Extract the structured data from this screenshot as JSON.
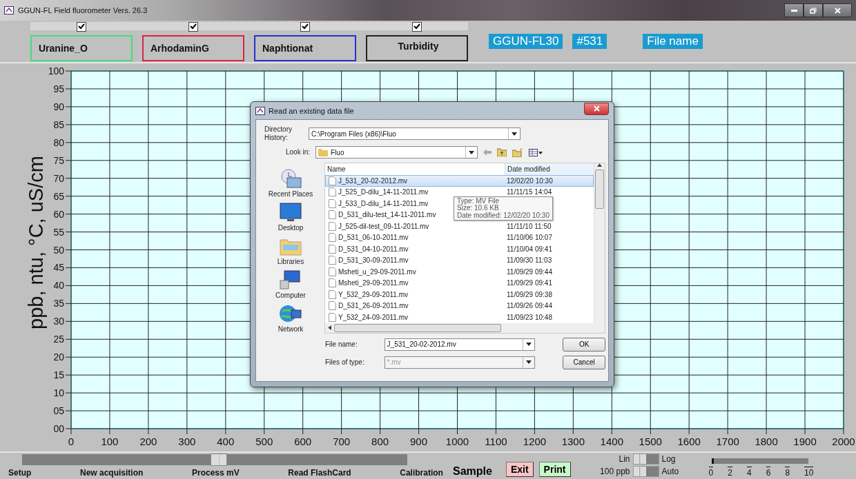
{
  "window": {
    "title": "GGUN-FL Field fluorometer Vers. 26.3"
  },
  "channels": [
    {
      "label": "Uranine_O",
      "checked": true,
      "color": "#44dd77"
    },
    {
      "label": "ArhodaminG",
      "checked": true,
      "color": "#dd2244"
    },
    {
      "label": "Naphtionat",
      "checked": true,
      "color": "#2233cc"
    },
    {
      "label": "Turbidity",
      "checked": true,
      "color": "#222222"
    }
  ],
  "info_labels": [
    "GGUN-FL30",
    "#531",
    "File name"
  ],
  "plot": {
    "ylabel": "ppb, ntu, °C, uS/cm",
    "yticks": [
      "100",
      "95",
      "90",
      "85",
      "80",
      "75",
      "70",
      "65",
      "60",
      "55",
      "50",
      "45",
      "40",
      "35",
      "30",
      "25",
      "20",
      "15",
      "10",
      "05",
      "00"
    ],
    "xticks": [
      "0",
      "100",
      "200",
      "300",
      "400",
      "500",
      "600",
      "700",
      "800",
      "900",
      "1000",
      "1100",
      "1200",
      "1300",
      "1400",
      "1500",
      "1600",
      "1700",
      "1800",
      "1900",
      "2000"
    ]
  },
  "dialog": {
    "title": "Read an existing data file",
    "directory_history": {
      "label": "Directory History:",
      "value": "C:\\Program Files (x86)\\Fluo"
    },
    "look_in": {
      "label": "Look in:",
      "value": "Fluo"
    },
    "places": [
      {
        "label": "Recent Places",
        "kind": "recent"
      },
      {
        "label": "Desktop",
        "kind": "desktop"
      },
      {
        "label": "Libraries",
        "kind": "libraries"
      },
      {
        "label": "Computer",
        "kind": "computer"
      },
      {
        "label": "Network",
        "kind": "network"
      }
    ],
    "columns": [
      "Name",
      "Date modified"
    ],
    "files": [
      {
        "name": "J_531_20-02-2012.mv",
        "date": "12/02/20 10:30",
        "selected": true
      },
      {
        "name": "J_525_D-dilu_14-11-2011.mv",
        "date": "11/11/15 14:04",
        "selected": false
      },
      {
        "name": "J_533_D-dilu_14-11-2011.mv",
        "selected": false
      },
      {
        "name": "D_531_dilu-test_14-11-2011.mv",
        "selected": false
      },
      {
        "name": "J_525-dil-test_09-11-2011.mv",
        "date": "11/11/10 11:50",
        "selected": false
      },
      {
        "name": "D_531_06-10-2011.mv",
        "date": "11/10/06 10:07",
        "selected": false
      },
      {
        "name": "D_531_04-10-2011.mv",
        "date": "11/10/04 09:41",
        "selected": false
      },
      {
        "name": "D_531_30-09-2011.mv",
        "date": "11/09/30 11:03",
        "selected": false
      },
      {
        "name": "Msheti_u_29-09-2011.mv",
        "date": "11/09/29 09:44",
        "selected": false
      },
      {
        "name": "Msheti_29-09-2011.mv",
        "date": "11/09/29 09:41",
        "selected": false
      },
      {
        "name": "Y_532_29-09-2011.mv",
        "date": "11/09/29 09:38",
        "selected": false
      },
      {
        "name": "D_531_26-09-2011.mv",
        "date": "11/09/26 09:44",
        "selected": false
      },
      {
        "name": "Y_532_24-09-2011.mv",
        "date": "11/09/23 10:48",
        "selected": false
      }
    ],
    "tooltip": [
      "Type: MV File",
      "Size: 10.6 KB",
      "Date modified: 12/02/20 10:30"
    ],
    "file_name": {
      "label": "File name:",
      "value": "J_531_20-02-2012.mv"
    },
    "file_type": {
      "label": "Files of type:",
      "value": "*.mv",
      "disabled": true
    },
    "buttons": [
      "OK",
      "Cancel"
    ]
  },
  "mode_slider": {
    "level": 0.51,
    "labels": [
      "Setup",
      "New acquisition",
      "Process mV",
      "Read FlashCard",
      "Calibration"
    ]
  },
  "sample_label": "Sample",
  "actions": [
    {
      "label": "Exit",
      "kind": "exit"
    },
    {
      "label": "Print",
      "kind": "print"
    }
  ],
  "toggles": [
    {
      "left": "Lin",
      "right": "Log",
      "on": false
    },
    {
      "left": "100 ppb",
      "right": "Auto",
      "on": false
    }
  ],
  "meter": {
    "level": 0,
    "ticks": [
      "0",
      "2",
      "4",
      "6",
      "8",
      "10"
    ]
  }
}
